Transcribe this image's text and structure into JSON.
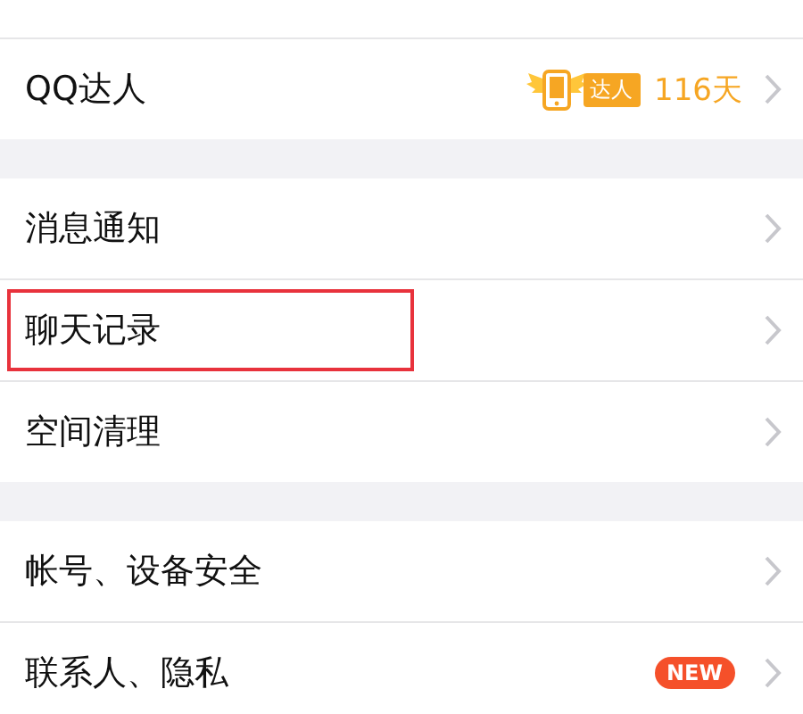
{
  "groups": [
    {
      "items": [
        {
          "label": "QQ达人",
          "highlighted": false,
          "badge": {
            "kind": "talent",
            "tag": "达人",
            "text": "116天"
          }
        }
      ]
    },
    {
      "items": [
        {
          "label": "消息通知",
          "highlighted": false
        },
        {
          "label": "聊天记录",
          "highlighted": true
        },
        {
          "label": "空间清理",
          "highlighted": false
        }
      ]
    },
    {
      "items": [
        {
          "label": "帐号、设备安全",
          "highlighted": false
        },
        {
          "label": "联系人、隐私",
          "highlighted": false,
          "badge": {
            "kind": "new",
            "tag": "NEW"
          }
        }
      ]
    }
  ]
}
